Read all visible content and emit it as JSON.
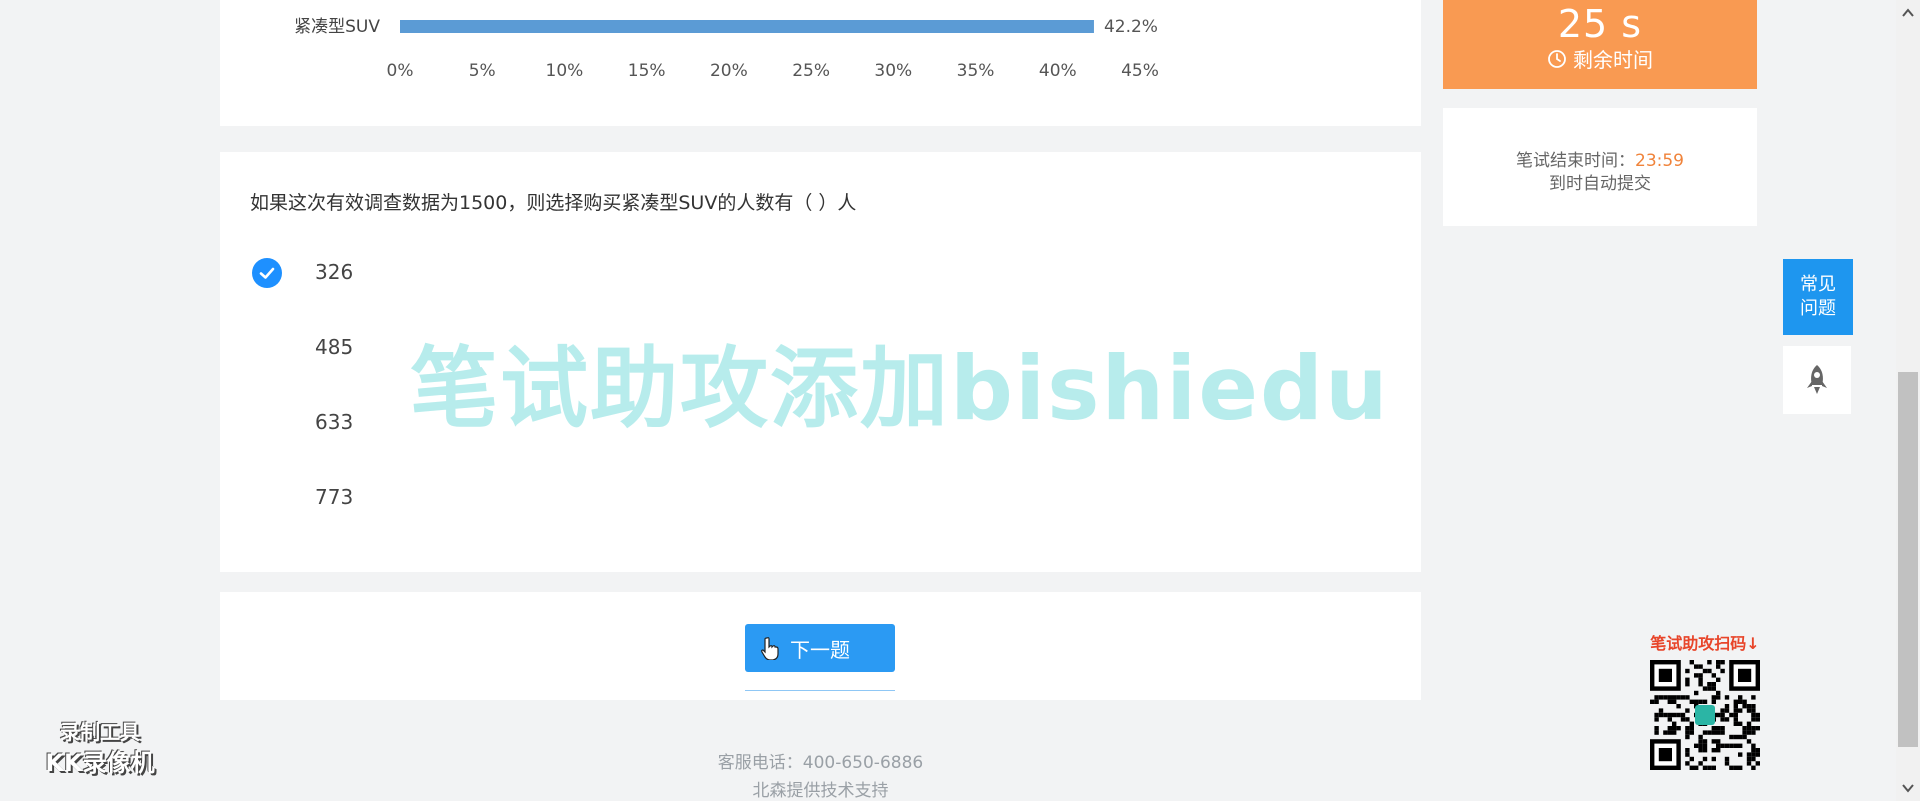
{
  "chart_data": {
    "type": "bar",
    "orientation": "horizontal",
    "categories": [
      "紧凑型SUV"
    ],
    "values": [
      42.2
    ],
    "value_labels": [
      "42.2%"
    ],
    "xlim": [
      0,
      45
    ],
    "x_ticks": [
      "0%",
      "5%",
      "10%",
      "15%",
      "20%",
      "25%",
      "30%",
      "35%",
      "40%",
      "45%"
    ],
    "bar_color": "#5b9bd5",
    "grid": false
  },
  "question": {
    "text": "如果这次有效调查数据为1500，则选择购买紧凑型SUV的人数有（ ）人",
    "options": [
      {
        "label": "326",
        "selected": true
      },
      {
        "label": "485",
        "selected": false
      },
      {
        "label": "633",
        "selected": false
      },
      {
        "label": "773",
        "selected": false
      }
    ]
  },
  "nav": {
    "next_label": "下一题"
  },
  "footer": {
    "phone": "客服电话：400-650-6886",
    "support": "北森提供技术支持"
  },
  "timer": {
    "value": "25 s",
    "label": "剩余时间",
    "color": "#f99a52"
  },
  "end_info": {
    "label": "笔试结束时间：",
    "time": "23:59",
    "note": "到时自动提交"
  },
  "side": {
    "faq_label": "常见\n问题"
  },
  "watermark": "笔试助攻添加bishiedu",
  "qr_promo": {
    "title": "笔试助攻扫码↓"
  },
  "recorder": {
    "line1": "录制工具",
    "line2": "KK录像机"
  }
}
